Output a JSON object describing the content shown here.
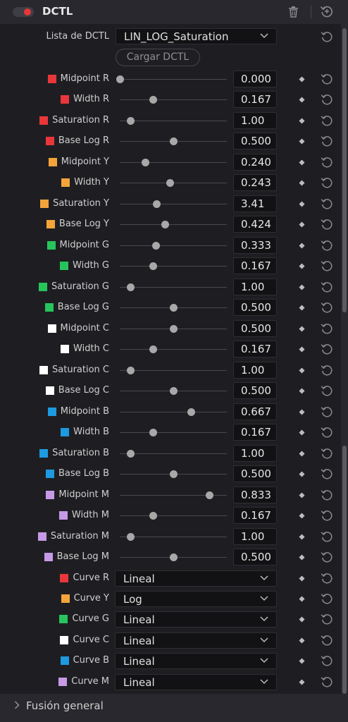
{
  "header": {
    "title": "DCTL",
    "enabled": true,
    "toggle_color": "#e8363a"
  },
  "dctl_list": {
    "label": "Lista de DCTL",
    "value": "LIN_LOG_Saturation"
  },
  "load_button": {
    "label": "Cargar DCTL"
  },
  "colors": {
    "R": "#e8373b",
    "Y": "#f4a43a",
    "G": "#27c45c",
    "C": "#ffffff",
    "B": "#1d9ae0",
    "M": "#c69ae6"
  },
  "params": [
    {
      "label": "Midpoint R",
      "swatch": "R",
      "value": "0.000",
      "level": 0.0
    },
    {
      "label": "Width R",
      "swatch": "R",
      "value": "0.167",
      "level": 0.31
    },
    {
      "label": "Saturation R",
      "swatch": "R",
      "value": "1.00",
      "level": 0.1
    },
    {
      "label": "Base Log R",
      "swatch": "R",
      "value": "0.500",
      "level": 0.5
    },
    {
      "label": "Midpoint Y",
      "swatch": "Y",
      "value": "0.240",
      "level": 0.24
    },
    {
      "label": "Width Y",
      "swatch": "Y",
      "value": "0.243",
      "level": 0.47
    },
    {
      "label": "Saturation Y",
      "swatch": "Y",
      "value": "3.41",
      "level": 0.34
    },
    {
      "label": "Base Log Y",
      "swatch": "Y",
      "value": "0.424",
      "level": 0.42
    },
    {
      "label": "Midpoint G",
      "swatch": "G",
      "value": "0.333",
      "level": 0.333
    },
    {
      "label": "Width G",
      "swatch": "G",
      "value": "0.167",
      "level": 0.31
    },
    {
      "label": "Saturation G",
      "swatch": "G",
      "value": "1.00",
      "level": 0.1
    },
    {
      "label": "Base Log G",
      "swatch": "G",
      "value": "0.500",
      "level": 0.5
    },
    {
      "label": "Midpoint C",
      "swatch": "C",
      "value": "0.500",
      "level": 0.5
    },
    {
      "label": "Width C",
      "swatch": "C",
      "value": "0.167",
      "level": 0.31
    },
    {
      "label": "Saturation C",
      "swatch": "C",
      "value": "1.00",
      "level": 0.1
    },
    {
      "label": "Base Log C",
      "swatch": "C",
      "value": "0.500",
      "level": 0.5
    },
    {
      "label": "Midpoint B",
      "swatch": "B",
      "value": "0.667",
      "level": 0.667
    },
    {
      "label": "Width B",
      "swatch": "B",
      "value": "0.167",
      "level": 0.31
    },
    {
      "label": "Saturation B",
      "swatch": "B",
      "value": "1.00",
      "level": 0.1
    },
    {
      "label": "Base Log B",
      "swatch": "B",
      "value": "0.500",
      "level": 0.5
    },
    {
      "label": "Midpoint M",
      "swatch": "M",
      "value": "0.833",
      "level": 0.833
    },
    {
      "label": "Width M",
      "swatch": "M",
      "value": "0.167",
      "level": 0.31
    },
    {
      "label": "Saturation M",
      "swatch": "M",
      "value": "1.00",
      "level": 0.1
    },
    {
      "label": "Base Log M",
      "swatch": "M",
      "value": "0.500",
      "level": 0.5
    }
  ],
  "curves": [
    {
      "label": "Curve R",
      "swatch": "R",
      "value": "Lineal"
    },
    {
      "label": "Curve Y",
      "swatch": "Y",
      "value": "Log"
    },
    {
      "label": "Curve G",
      "swatch": "G",
      "value": "Lineal"
    },
    {
      "label": "Curve C",
      "swatch": "C",
      "value": "Lineal"
    },
    {
      "label": "Curve B",
      "swatch": "B",
      "value": "Lineal"
    },
    {
      "label": "Curve M",
      "swatch": "M",
      "value": "Lineal"
    }
  ],
  "footer": {
    "label": "Fusión general"
  },
  "icons": {
    "toggle": "toggle-switch",
    "trash": "trash-icon",
    "reset_all": "reset-all-icon",
    "keyframe": "keyframe-diamond-icon",
    "reset": "reset-icon",
    "chevron": "chevron-down-icon",
    "expand": "chevron-right-icon"
  }
}
